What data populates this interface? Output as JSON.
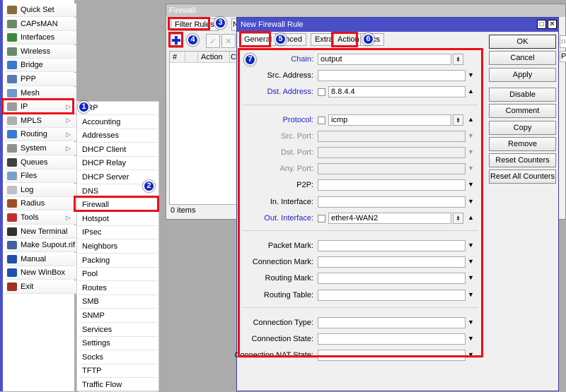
{
  "sidebar": {
    "items": [
      {
        "label": "Quick Set",
        "icon": "wand-icon",
        "color": "#8a6a3a"
      },
      {
        "label": "CAPsMAN",
        "icon": "antenna-icon",
        "color": "#6a8a6a"
      },
      {
        "label": "Interfaces",
        "icon": "network-card-icon",
        "color": "#3a8a3a"
      },
      {
        "label": "Wireless",
        "icon": "antenna-icon",
        "color": "#6a8a6a"
      },
      {
        "label": "Bridge",
        "icon": "bridge-icon",
        "color": "#3a7ad0"
      },
      {
        "label": "PPP",
        "icon": "ppp-icon",
        "color": "#5a7ab0"
      },
      {
        "label": "Mesh",
        "icon": "mesh-icon",
        "color": "#6a9ad0"
      },
      {
        "label": "IP",
        "icon": "ip-icon",
        "color": "#9a9a9a",
        "submenu": true
      },
      {
        "label": "MPLS",
        "icon": "mpls-icon",
        "color": "#b0b0b0",
        "submenu": true
      },
      {
        "label": "Routing",
        "icon": "routing-icon",
        "color": "#3a7ad0",
        "submenu": true
      },
      {
        "label": "System",
        "icon": "gear-icon",
        "color": "#909090",
        "submenu": true
      },
      {
        "label": "Queues",
        "icon": "queues-icon",
        "color": "#404040"
      },
      {
        "label": "Files",
        "icon": "folder-icon",
        "color": "#7aa0c8"
      },
      {
        "label": "Log",
        "icon": "log-icon",
        "color": "#c0c0c0"
      },
      {
        "label": "Radius",
        "icon": "radius-icon",
        "color": "#a05020"
      },
      {
        "label": "Tools",
        "icon": "tools-icon",
        "color": "#c03030",
        "submenu": true
      },
      {
        "label": "New Terminal",
        "icon": "terminal-icon",
        "color": "#303030"
      },
      {
        "label": "Make Supout.rif",
        "icon": "supout-icon",
        "color": "#4060a0"
      },
      {
        "label": "Manual",
        "icon": "help-icon",
        "color": "#2050b0"
      },
      {
        "label": "New WinBox",
        "icon": "winbox-icon",
        "color": "#2050b0"
      },
      {
        "label": "Exit",
        "icon": "exit-icon",
        "color": "#a03020"
      }
    ]
  },
  "ip_submenu": {
    "items": [
      "ARP",
      "Accounting",
      "Addresses",
      "DHCP Client",
      "DHCP Relay",
      "DHCP Server",
      "DNS",
      "Firewall",
      "Hotspot",
      "IPsec",
      "Neighbors",
      "Packing",
      "Pool",
      "Routes",
      "SMB",
      "SNMP",
      "Services",
      "Settings",
      "Socks",
      "TFTP",
      "Traffic Flow"
    ]
  },
  "firewall": {
    "title": "Firewall",
    "tabs": [
      "Filter Rules",
      "N"
    ],
    "columns": [
      "#",
      "",
      "Action",
      "Ch"
    ],
    "status": "0 items",
    "right_col": "P",
    "search_partial": "nd"
  },
  "dialog": {
    "title": "New Firewall Rule",
    "tabs": [
      "General",
      "Advanced",
      "Extra",
      "Action",
      "Statistics"
    ],
    "tabs_visible": [
      "General",
      "anced",
      "Extra",
      "Action",
      "stics"
    ],
    "rows": [
      {
        "label": "Chain:",
        "value": "output",
        "style": "blue",
        "type": "select"
      },
      {
        "label": "Src. Address:",
        "value": "",
        "style": "",
        "type": "down"
      },
      {
        "label": "Dst. Address:",
        "value": "8.8.4.4",
        "style": "blue",
        "type": "check-up"
      },
      {
        "sep": true
      },
      {
        "label": "Protocol:",
        "value": "icmp",
        "style": "blue",
        "type": "check-select"
      },
      {
        "label": "Src. Port:",
        "value": "",
        "style": "gray",
        "type": "disabled"
      },
      {
        "label": "Dst. Port:",
        "value": "",
        "style": "gray",
        "type": "disabled"
      },
      {
        "label": "Any. Port:",
        "value": "",
        "style": "gray",
        "type": "disabled"
      },
      {
        "label": "P2P:",
        "value": "",
        "style": "",
        "type": "down"
      },
      {
        "label": "In. Interface:",
        "value": "",
        "style": "",
        "type": "down"
      },
      {
        "label": "Out. Interface:",
        "value": "ether4-WAN2",
        "style": "blue",
        "type": "check-select"
      },
      {
        "sep": true
      },
      {
        "label": "Packet Mark:",
        "value": "",
        "style": "",
        "type": "down"
      },
      {
        "label": "Connection Mark:",
        "value": "",
        "style": "",
        "type": "down"
      },
      {
        "label": "Routing Mark:",
        "value": "",
        "style": "",
        "type": "down"
      },
      {
        "label": "Routing Table:",
        "value": "",
        "style": "",
        "type": "down"
      },
      {
        "sep": true
      },
      {
        "label": "Connection Type:",
        "value": "",
        "style": "",
        "type": "down"
      },
      {
        "label": "Connection State:",
        "value": "",
        "style": "",
        "type": "down"
      },
      {
        "label": "Connection NAT State:",
        "value": "",
        "style": "",
        "type": "down"
      }
    ],
    "buttons": [
      "OK",
      "Cancel",
      "Apply",
      "Disable",
      "Comment",
      "Copy",
      "Remove",
      "Reset Counters",
      "Reset All Counters"
    ]
  },
  "annotations": [
    "1",
    "2",
    "3",
    "4",
    "5",
    "6",
    "7"
  ],
  "colors": {
    "highlight": "#e8101a",
    "badge": "#1028c8",
    "titlebar": "#4a4fc8"
  }
}
